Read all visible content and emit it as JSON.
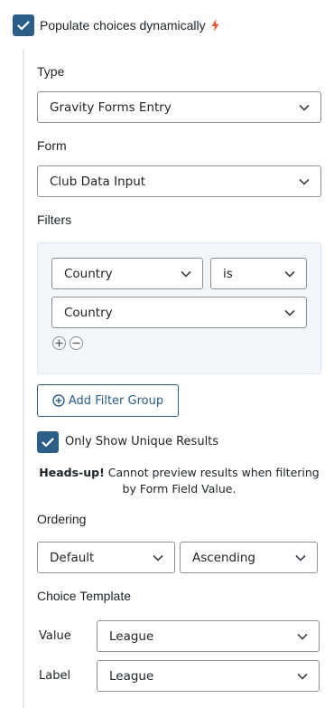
{
  "populate": {
    "label": "Populate choices dynamically",
    "checked": true,
    "icon": "lightning-icon",
    "accent": "#2b5f88",
    "bolt_color": "#e5532d"
  },
  "type": {
    "label": "Type",
    "value": "Gravity Forms Entry"
  },
  "form": {
    "label": "Form",
    "value": "Club Data Input"
  },
  "filters": {
    "label": "Filters",
    "field": "Country",
    "operator": "is",
    "value": "Country",
    "add_group_label": "Add Filter Group"
  },
  "unique": {
    "label": "Only Show Unique Results",
    "checked": true
  },
  "notice": {
    "strong": "Heads-up!",
    "text": " Cannot preview results when filtering by Form Field Value."
  },
  "ordering": {
    "label": "Ordering",
    "by": "Default",
    "direction": "Ascending"
  },
  "template": {
    "label": "Choice Template",
    "value_label": "Value",
    "value": "League",
    "label_label": "Label",
    "label_value": "League"
  }
}
